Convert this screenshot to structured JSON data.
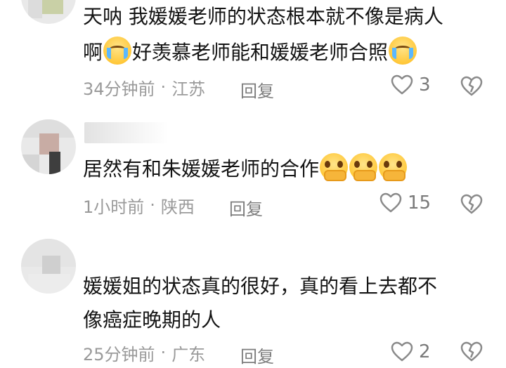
{
  "comments": [
    {
      "text_lines": [
        "天呐 我媛媛老师的状态根本就不像是病人",
        "啊",
        "好羡慕老师能和媛媛老师合照"
      ],
      "time": "34分钟前",
      "location": "江苏",
      "reply_label": "回复",
      "like_count": "3"
    },
    {
      "username": "",
      "text_lines": [
        "居然有和朱媛媛老师的合作"
      ],
      "time": "1小时前",
      "location": "陕西",
      "reply_label": "回复",
      "like_count": "15"
    },
    {
      "text_lines": [
        "媛媛姐的状态真的很好，真的看上去都不",
        "像癌症晚期的人"
      ],
      "time": "25分钟前",
      "location": "广东",
      "reply_label": "回复",
      "like_count": "2"
    }
  ],
  "separator": "·",
  "icons": {
    "like": "heart-outline-icon",
    "dislike": "broken-heart-icon",
    "crying": "loudly-crying-face-emoji",
    "pleading": "holding-back-tears-emoji"
  },
  "colors": {
    "text": "#141414",
    "meta": "#9a9a9a",
    "reply": "#7d7d7d"
  }
}
